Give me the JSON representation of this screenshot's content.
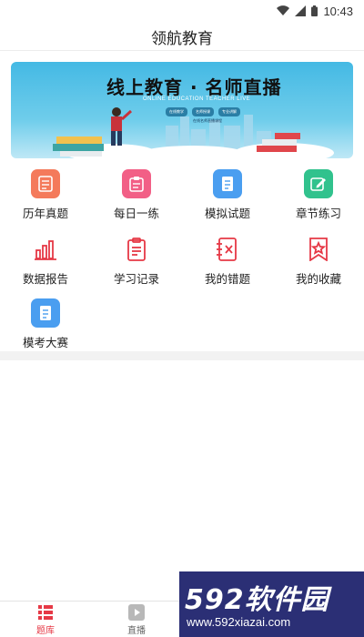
{
  "status": {
    "time": "10:43"
  },
  "header": {
    "title": "领航教育"
  },
  "banner": {
    "title": "线上教育 · 名师直播",
    "subtitle": "ONLINE EDUCATION TEACHER LIVE",
    "tags": [
      "在线教学",
      "名师授课",
      "专业讲解"
    ],
    "footnote": "在线名师直播课程"
  },
  "grid": [
    {
      "label": "历年真题",
      "icon": "paper-icon",
      "color": "#f47a5b"
    },
    {
      "label": "每日一练",
      "icon": "clipboard-icon",
      "color": "#f25f86"
    },
    {
      "label": "模拟试题",
      "icon": "document-icon",
      "color": "#4a9ef0"
    },
    {
      "label": "章节练习",
      "icon": "edit-icon",
      "color": "#31c28d"
    },
    {
      "label": "数据报告",
      "icon": "bar-chart-icon",
      "color": "#e63946"
    },
    {
      "label": "学习记录",
      "icon": "clipboard-list-icon",
      "color": "#e63946"
    },
    {
      "label": "我的错题",
      "icon": "error-book-icon",
      "color": "#e63946"
    },
    {
      "label": "我的收藏",
      "icon": "bookmark-star-icon",
      "color": "#e63946"
    },
    {
      "label": "模考大赛",
      "icon": "exam-icon",
      "color": "#4a9ef0"
    }
  ],
  "tabs": [
    {
      "label": "题库",
      "icon": "question-bank-icon",
      "active": true
    },
    {
      "label": "直播",
      "icon": "play-icon",
      "active": false
    }
  ],
  "watermark": {
    "text": "592软件园",
    "url": "www.592xiazai.com"
  },
  "colors": {
    "accent": "#e63946",
    "tab_active": "#e63946",
    "tab_inactive": "#666666"
  }
}
